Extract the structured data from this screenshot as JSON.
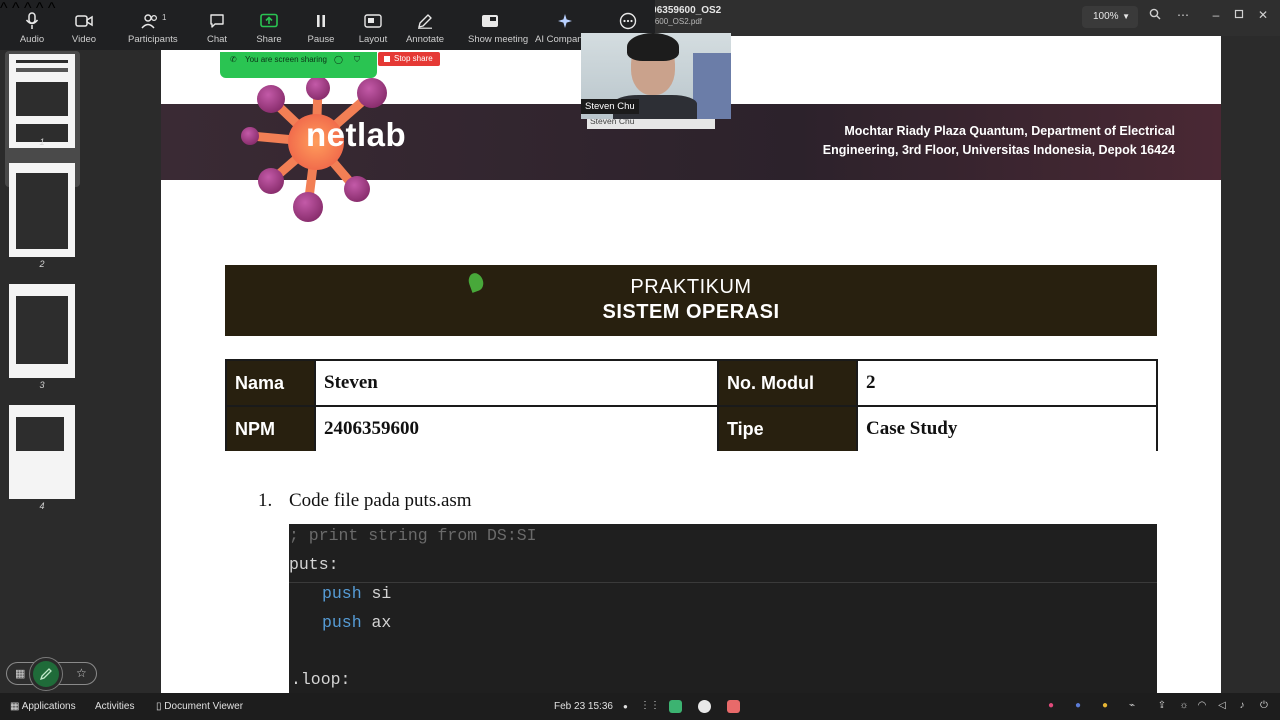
{
  "viewer": {
    "title": "02_DN_Steven_2406359600_OS2",
    "filename": "02_DN_Steven_2406359600_OS2.pdf",
    "zoom": "100%"
  },
  "zoom_toolbar": {
    "buttons": [
      {
        "id": "audio",
        "label": "Audio"
      },
      {
        "id": "video",
        "label": "Video"
      },
      {
        "id": "participants",
        "label": "Participants",
        "count": "1"
      },
      {
        "id": "chat",
        "label": "Chat"
      },
      {
        "id": "share",
        "label": "Share"
      },
      {
        "id": "pause",
        "label": "Pause"
      },
      {
        "id": "layout",
        "label": "Layout"
      },
      {
        "id": "annotate",
        "label": "Annotate"
      },
      {
        "id": "show_meeting",
        "label": "Show meeting"
      },
      {
        "id": "ai_companion",
        "label": "AI Companion"
      }
    ],
    "more_icon": "more-icon"
  },
  "sharing": {
    "status": "You are screen sharing",
    "stop_label": "Stop share"
  },
  "video": {
    "name": "Steven Chu",
    "name_secondary": "Steven Chu"
  },
  "thumbnails": [
    "1",
    "2",
    "3",
    "4"
  ],
  "document": {
    "address_line1": "Mochtar Riady Plaza Quantum, Department of Electrical",
    "address_line2": "Engineering, 3rd Floor, Universitas Indonesia, Depok 16424",
    "logo_text": "netlab",
    "title_line1": "PRAKTIKUM",
    "title_line2": "SISTEM OPERASI",
    "info": {
      "nama_label": "Nama",
      "nama_value": "Steven",
      "npm_label": "NPM",
      "npm_value": "2406359600",
      "modul_label": "No. Modul",
      "modul_value": "2",
      "tipe_label": "Tipe",
      "tipe_value": "Case Study"
    },
    "question_number": "1.",
    "question_text": "Code file pada puts.asm",
    "code": {
      "comment": "; print string from DS:SI",
      "label1": "puts:",
      "kw1": "push",
      "arg1": " si",
      "kw2": "push",
      "arg2": " ax",
      "label2": ".loop:"
    }
  },
  "taskbar": {
    "applications": "Applications",
    "activities": "Activities",
    "document_viewer": "Document Viewer",
    "datetime": "Feb 23  15:36"
  },
  "colors": {
    "banner": "#2c222b",
    "title_box": "#28200f",
    "share_green": "#2ac452",
    "stop_red": "#e53935",
    "code_bg": "#1f1f1f"
  }
}
